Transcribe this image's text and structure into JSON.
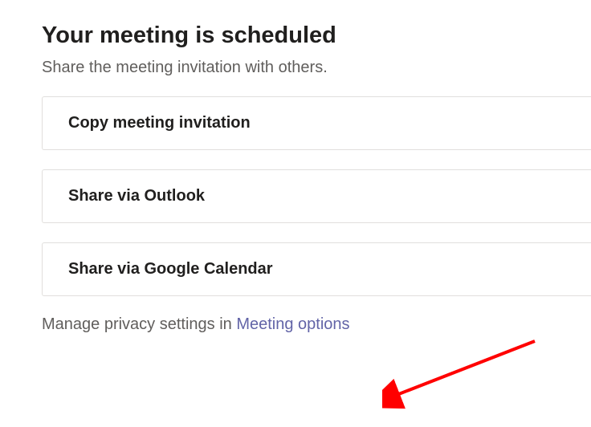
{
  "heading": "Your meeting is scheduled",
  "subtitle": "Share the meeting invitation with others.",
  "buttons": {
    "copy": "Copy meeting invitation",
    "outlook": "Share via Outlook",
    "google": "Share via Google Calendar"
  },
  "footer": {
    "prefix": "Manage privacy settings in ",
    "link": "Meeting options"
  }
}
